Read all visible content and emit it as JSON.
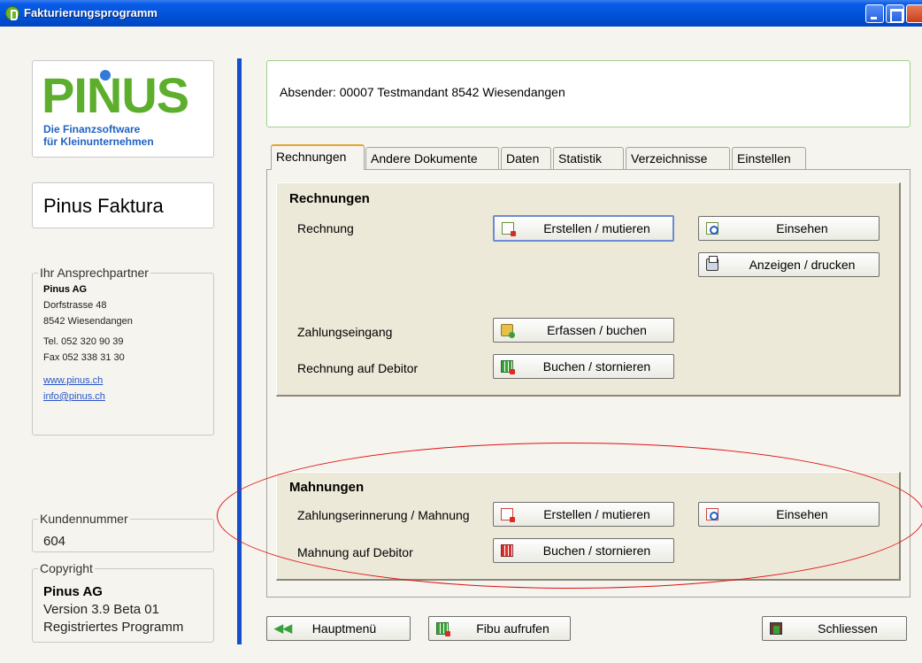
{
  "window": {
    "title": "Fakturierungsprogramm"
  },
  "logo": {
    "word": "PINUS",
    "sub1": "Die Finanzsoftware",
    "sub2": "für Kleinunternehmen"
  },
  "product": {
    "name": "Pinus Faktura"
  },
  "contact": {
    "legend": "Ihr Ansprechpartner",
    "company": "Pinus AG",
    "street": "Dorfstrasse 48",
    "city": "8542 Wiesendangen",
    "tel": "Tel. 052 320 90 39",
    "fax": "Fax  052 338 31 30",
    "web": "www.pinus.ch",
    "email": "info@pinus.ch"
  },
  "customer": {
    "legend": "Kundennummer",
    "value": "604"
  },
  "copyright": {
    "legend": "Copyright",
    "company": "Pinus AG",
    "version": "Version 3.9 Beta 01",
    "status": "Registriertes Programm"
  },
  "sender": {
    "text": "Absender: 00007 Testmandant   8542 Wiesendangen"
  },
  "tabs": [
    {
      "label": "Rechnungen"
    },
    {
      "label": "Andere Dokumente"
    },
    {
      "label": "Daten"
    },
    {
      "label": "Statistik"
    },
    {
      "label": "Verzeichnisse"
    },
    {
      "label": "Einstellen"
    }
  ],
  "invoices": {
    "title": "Rechnungen",
    "rechnung_label": "Rechnung",
    "create_btn": "Erstellen / mutieren",
    "view_btn": "Einsehen",
    "print_btn": "Anzeigen / drucken",
    "payment_label": "Zahlungseingang",
    "payment_btn": "Erfassen / buchen",
    "debtor_label": "Rechnung auf Debitor",
    "debtor_btn": "Buchen / stornieren"
  },
  "reminders": {
    "title": "Mahnungen",
    "reminder_label": "Zahlungserinnerung / Mahnung",
    "create_btn": "Erstellen / mutieren",
    "view_btn": "Einsehen",
    "debtor_label": "Mahnung auf Debitor",
    "debtor_btn": "Buchen / stornieren"
  },
  "footer": {
    "main_menu_btn": "Hauptmenü",
    "fibu_btn": "Fibu aufrufen",
    "close_btn": "Schliessen"
  }
}
